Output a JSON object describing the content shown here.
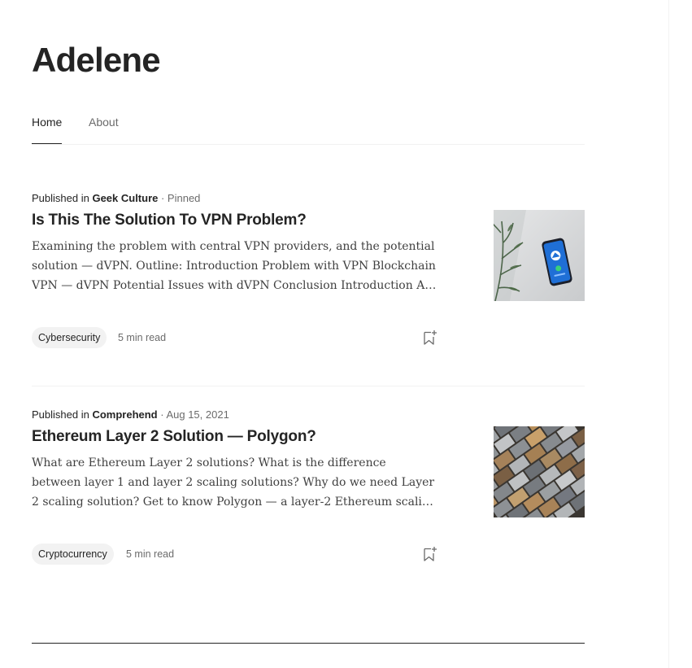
{
  "profile": {
    "name": "Adelene"
  },
  "tabs": [
    {
      "label": "Home",
      "active": true
    },
    {
      "label": "About",
      "active": false
    }
  ],
  "articles": [
    {
      "published_prefix": "Published in",
      "publication": "Geek Culture",
      "meta": " · Pinned",
      "title": "Is This The Solution To VPN Problem?",
      "excerpt": "Examining the problem with central VPN providers, and the potential solution — dVPN. Outline: Introduction Problem with VPN Blockchain VPN — dVPN Potential Issues with dVPN Conclusion Introduction A…",
      "tag": "Cybersecurity",
      "read_time": "5 min read",
      "thumbnail": "phone-vpn-image"
    },
    {
      "published_prefix": "Published in",
      "publication": "Comprehend",
      "meta": " · Aug 15, 2021",
      "title": "Ethereum Layer 2 Solution — Polygon?",
      "excerpt": "What are Ethereum Layer 2 solutions? What is the difference between layer 1 and layer 2 scaling solutions? Why do we need Layer 2 scaling solution? Get to know Polygon — a layer-2 Ethereum scaling project.…",
      "tag": "Cryptocurrency",
      "read_time": "5 min read",
      "thumbnail": "stone-tiles-image"
    }
  ],
  "icons": {
    "bookmark": "bookmark-add-icon"
  },
  "colors": {
    "text": "#242424",
    "muted": "#6b6b6b",
    "tag_bg": "#f2f2f2",
    "divider": "#f2f2f2"
  }
}
